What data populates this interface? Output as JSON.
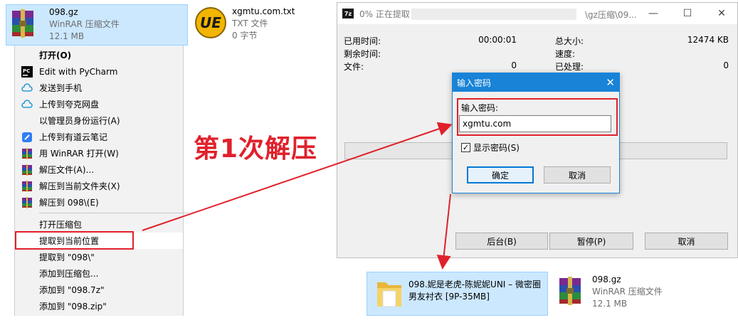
{
  "top_files": {
    "gz": {
      "name": "098.gz",
      "type": "WinRAR 压缩文件",
      "size": "12.1 MB",
      "icon": "winrar-archive-icon"
    },
    "txt": {
      "name": "xgmtu.com.txt",
      "type": "TXT 文件",
      "size": "0 字节",
      "icon": "ultraedit-icon"
    }
  },
  "context_menu": {
    "items": [
      {
        "label": "打开(O)",
        "icon": "",
        "bold": true
      },
      {
        "label": "Edit with PyCharm",
        "icon": "pycharm-icon"
      },
      {
        "label": "发送到手机",
        "icon": "cloud-icon"
      },
      {
        "label": "上传到夸克网盘",
        "icon": "cloud-icon"
      },
      {
        "label": "以管理员身份运行(A)",
        "icon": ""
      },
      {
        "label": "上传到有道云笔记",
        "icon": "youdao-note-icon"
      },
      {
        "label": "用 WinRAR 打开(W)",
        "icon": "winrar-icon"
      },
      {
        "label": "解压文件(A)...",
        "icon": "winrar-icon"
      },
      {
        "label": "解压到当前文件夹(X)",
        "icon": "winrar-icon"
      },
      {
        "label": "解压到 098\\(E)",
        "icon": "winrar-icon"
      },
      {
        "label": "打开压缩包",
        "icon": ""
      },
      {
        "label": "提取到当前位置",
        "icon": "",
        "highlighted": true
      },
      {
        "label": "提取到 \"098\\\"",
        "icon": ""
      },
      {
        "label": "添加到压缩包...",
        "icon": ""
      },
      {
        "label": "添加到 \"098.7z\"",
        "icon": ""
      },
      {
        "label": "添加到 \"098.zip\"",
        "icon": ""
      }
    ]
  },
  "annotation": {
    "text": "第1次解压",
    "color": "#e0212b"
  },
  "progress_window": {
    "title": "0% 正在提取",
    "title_path": "\\gz压缩\\09...",
    "stats": {
      "elapsed_label": "已用时间:",
      "elapsed_value": "00:00:01",
      "remaining_label": "剩余时间:",
      "remaining_value": "",
      "files_label": "文件:",
      "files_value": "0",
      "total_label": "总大小:",
      "total_value": "12474 KB",
      "speed_label": "速度:",
      "speed_value": "",
      "processed_label": "已处理:",
      "processed_value": "0"
    },
    "progress": 0,
    "buttons": {
      "background": "后台(B)",
      "pause": "暂停(P)",
      "cancel": "取消"
    }
  },
  "password_dialog": {
    "title": "输入密码",
    "label": "输入密码:",
    "value": "xgmtu.com",
    "show_password_label": "显示密码(S)",
    "show_password_checked": true,
    "ok": "确定",
    "cancel": "取消"
  },
  "result": {
    "folder": {
      "name": "098.妮是老虎-陈妮妮UNI – 微密圈男友衬衣 [9P-35MB]",
      "icon": "folder-icon"
    },
    "gz": {
      "name": "098.gz",
      "type": "WinRAR 压缩文件",
      "size": "12.1 MB",
      "icon": "winrar-archive-icon"
    }
  },
  "colors": {
    "selection": "#cce8ff",
    "accent": "#1883d7",
    "annotation_red": "#e0212b"
  }
}
